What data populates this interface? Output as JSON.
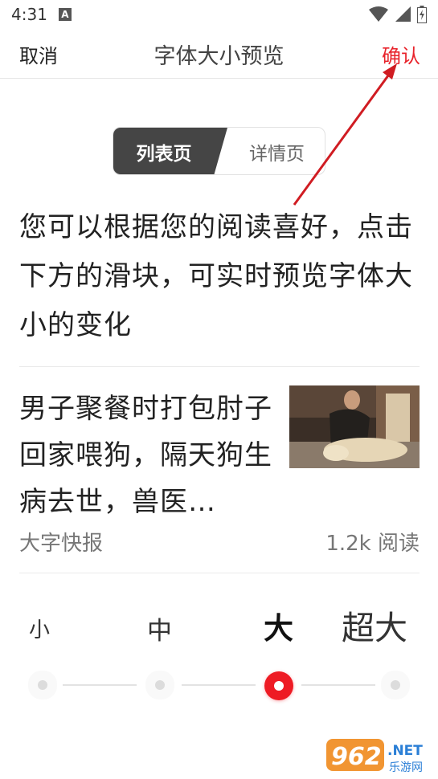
{
  "status_bar": {
    "time": "4:31",
    "notification_icon": "a-icon",
    "wifi_icon": "wifi-icon",
    "signal_icon": "signal-icon",
    "battery_icon": "battery-icon"
  },
  "header": {
    "cancel_label": "取消",
    "title": "字体大小预览",
    "confirm_label": "确认",
    "confirm_color": "#e8232b"
  },
  "segmented": {
    "tabs": [
      "列表页",
      "详情页"
    ],
    "active_index": 0
  },
  "intro_text": "您可以根据您的阅读喜好，点击下方的滑块，可实时预览字体大小的变化",
  "article": {
    "title": "男子聚餐时打包肘子回家喂狗，隔天狗生病去世，兽医…",
    "source": "大字快报",
    "reads": "1.2k 阅读"
  },
  "font_sizes": {
    "options": [
      "小",
      "中",
      "大",
      "超大"
    ],
    "selected_index": 2,
    "accent_color": "#ee1b24"
  },
  "watermark": {
    "brand_number": "962",
    "brand_suffix": ".NET",
    "brand_tagline": "乐游网"
  }
}
